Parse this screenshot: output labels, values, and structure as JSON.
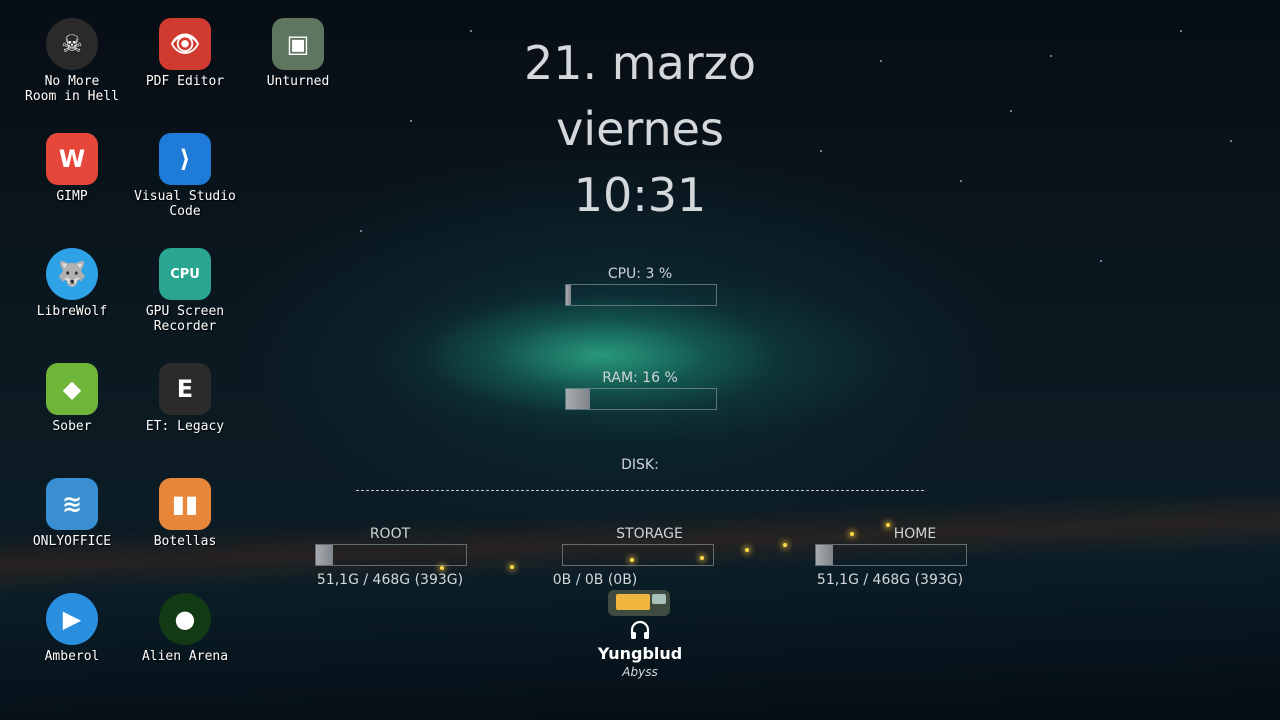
{
  "desktop_icons": [
    {
      "label": "No More\nRoom in Hell",
      "icon": "skull-portrait-icon",
      "bg": "#2a2a2a",
      "col": 0,
      "row": 0
    },
    {
      "label": "PDF Editor",
      "icon": "pdf-eye-icon",
      "bg": "#d13b2f",
      "col": 1,
      "row": 0
    },
    {
      "label": "Unturned",
      "icon": "zombie-head-icon",
      "bg": "#5e7560",
      "col": 2,
      "row": 0
    },
    {
      "label": "GIMP",
      "icon": "gimp-icon",
      "bg": "#e5483b",
      "col": 0,
      "row": 1
    },
    {
      "label": "Visual Studio\nCode",
      "icon": "vscode-icon",
      "bg": "#1f7bd8",
      "col": 1,
      "row": 1
    },
    {
      "label": "LibreWolf",
      "icon": "librewolf-icon",
      "bg": "#2ea2e6",
      "col": 0,
      "row": 2
    },
    {
      "label": "GPU Screen\nRecorder",
      "icon": "gpu-screen-recorder-icon",
      "bg": "#2aa592",
      "col": 1,
      "row": 2
    },
    {
      "label": "Sober",
      "icon": "sober-icon",
      "bg": "#6fb53a",
      "col": 0,
      "row": 3
    },
    {
      "label": "ET: Legacy",
      "icon": "et-legacy-icon",
      "bg": "#2b2b2b",
      "col": 1,
      "row": 3
    },
    {
      "label": "ONLYOFFICE",
      "icon": "onlyoffice-icon",
      "bg": "#3a8fd0",
      "col": 0,
      "row": 4
    },
    {
      "label": "Botellas",
      "icon": "bottles-icon",
      "bg": "#e8863a",
      "col": 1,
      "row": 4
    },
    {
      "label": "Amberol",
      "icon": "amberol-play-icon",
      "bg": "#2b8fe0",
      "col": 0,
      "row": 5
    },
    {
      "label": "Alien Arena",
      "icon": "alien-arena-icon",
      "bg": "#123a14",
      "col": 1,
      "row": 5
    }
  ],
  "conky": {
    "date": "21. marzo",
    "weekday": "viernes",
    "time": "10:31",
    "cpu_label": "CPU: 3 %",
    "cpu_percent": 3,
    "ram_label": "RAM: 16 %",
    "ram_percent": 16,
    "disk_label": "DISK:",
    "disks": [
      {
        "name": "ROOT",
        "usage": "51,1G / 468G (393G)",
        "fraction": 0.11
      },
      {
        "name": "STORAGE",
        "usage": "0B / 0B (0B)",
        "fraction": 0.0
      },
      {
        "name": "HOME",
        "usage": "51,1G / 468G (393G)",
        "fraction": 0.11
      }
    ]
  },
  "now_playing": {
    "icon": "headphones-icon",
    "artist": "Yungblud",
    "album": "Abyss"
  }
}
